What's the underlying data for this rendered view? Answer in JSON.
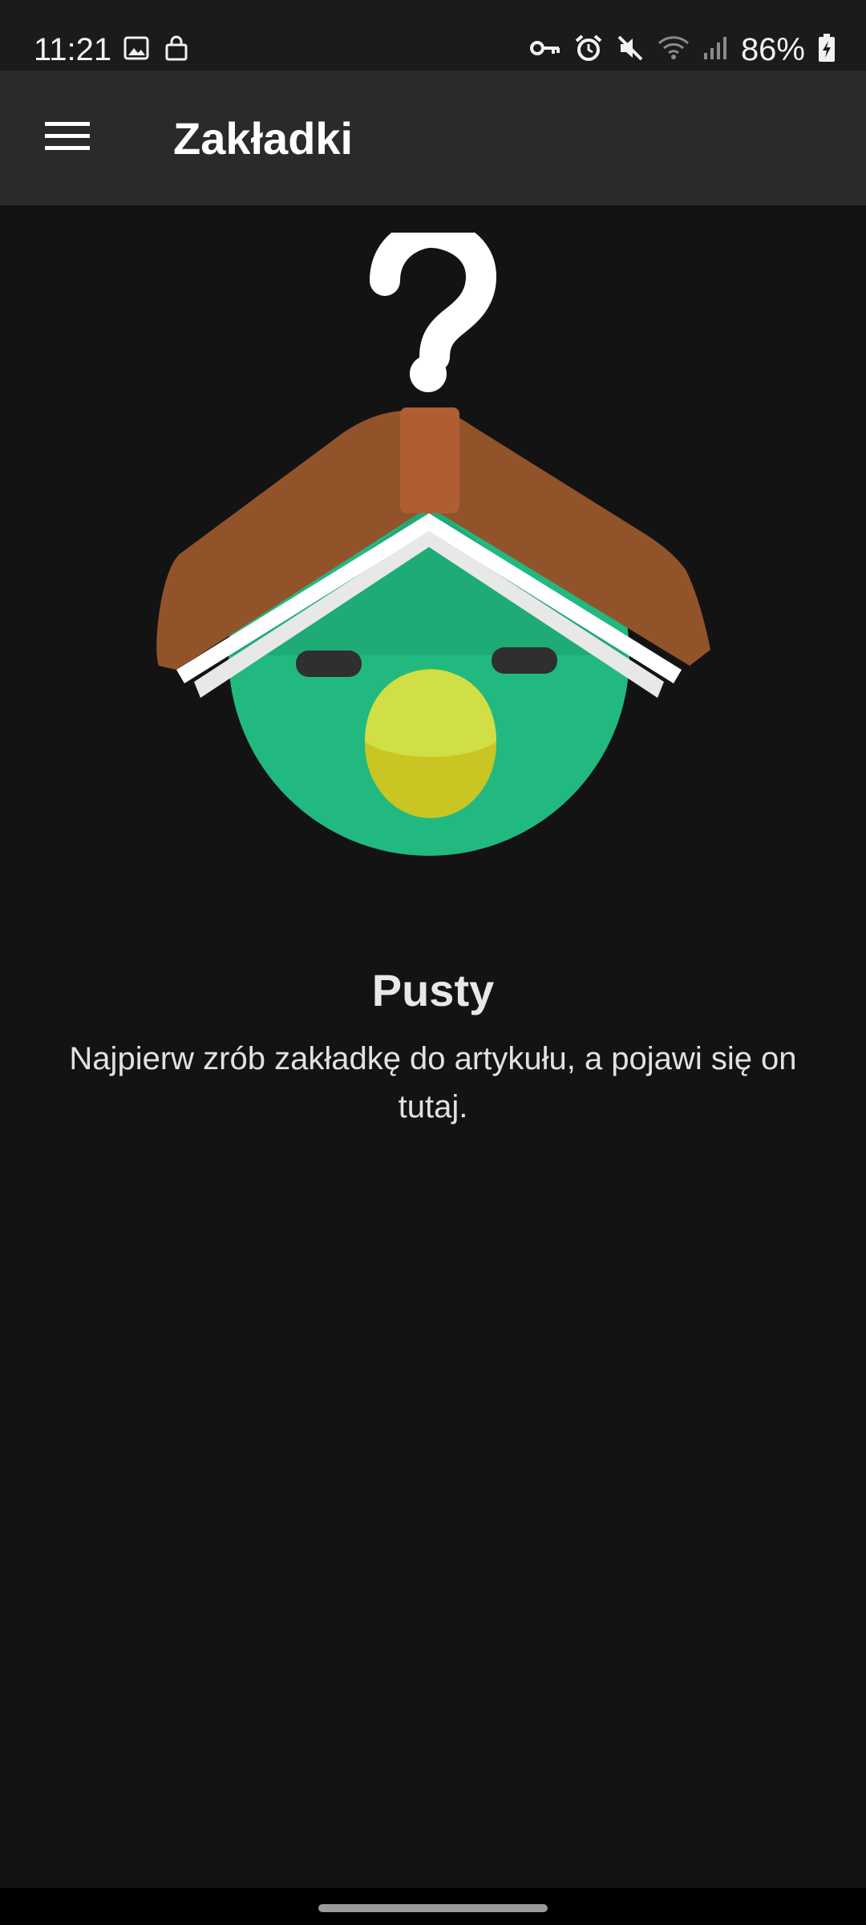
{
  "status_bar": {
    "time": "11:21",
    "battery": "86%",
    "left_icons": [
      "image-icon",
      "lock-bag-icon"
    ],
    "right_icons": [
      "vpn-key-icon",
      "alarm-icon",
      "mute-icon",
      "wifi-icon",
      "signal-icon",
      "battery-charging-icon"
    ]
  },
  "toolbar": {
    "title": "Zakładki",
    "menu_icon": "hamburger-menu-icon"
  },
  "empty_state": {
    "title": "Pusty",
    "message": "Najpierw zrób zakładkę do artykułu, a pojawi się on tutaj."
  },
  "colors": {
    "background": "#131313",
    "toolbar": "#2a2a2a",
    "face_green": "#21b980",
    "beak": "#d0df45",
    "book": "#93532a",
    "spine": "#ae5e30"
  }
}
